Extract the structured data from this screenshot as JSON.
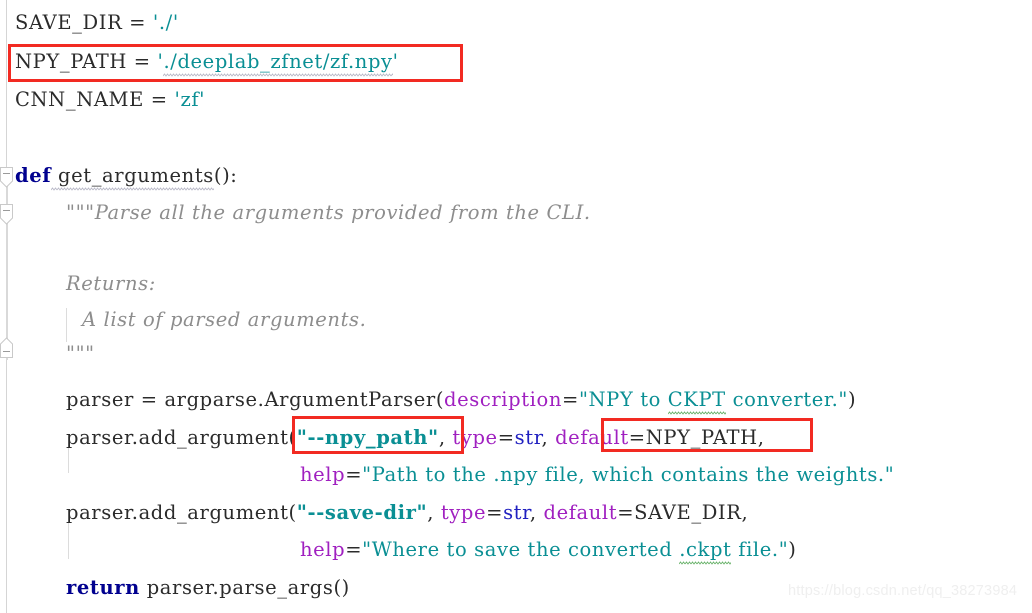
{
  "editor": {
    "language": "Python",
    "background": "#ffffff",
    "colors": {
      "keyword": "#00008f",
      "string": "#0a8f94",
      "keyword_argument": "#a020c0",
      "builtin": "#2020c0",
      "identifier": "#2b2b2b",
      "docstring": "#8d8d8d",
      "annotation_box": "#f22a22",
      "gutter_line": "#d5d5d5",
      "spellcheck_squiggle": "#b9b9c8",
      "typo_squiggle": "#69b36b",
      "watermark": "#efefef"
    }
  },
  "gutter": {
    "fold_markers": [
      {
        "name": "fold-marker-def-get-arguments",
        "state": "expanded",
        "glyph": "minus"
      },
      {
        "name": "fold-marker-docstring",
        "state": "expanded",
        "glyph": "minus"
      },
      {
        "name": "fold-marker-docstring-end",
        "state": "expanded",
        "glyph": "minus"
      }
    ]
  },
  "code": {
    "lines": [
      {
        "id": "line-save-dir",
        "text": "SAVE_DIR = './'",
        "tokens": {
          "name": "SAVE_DIR",
          "operator": "=",
          "value": "'./'"
        }
      },
      {
        "id": "line-npy-path",
        "text": "NPY_PATH = './deeplab_zfnet/zf.npy'",
        "tokens": {
          "name": "NPY_PATH",
          "operator": "=",
          "quote_open": "'",
          "value": "./deeplab_zfnet/zf.npy",
          "quote_close": "'"
        }
      },
      {
        "id": "line-cnn-name",
        "text": "CNN_NAME = 'zf'",
        "tokens": {
          "name": "CNN_NAME",
          "operator": "=",
          "value": "'zf'"
        }
      },
      {
        "id": "line-def",
        "text": "def get_arguments():",
        "tokens": {
          "keyword": "def",
          "func_name": "get_arguments",
          "parens": "()",
          "colon": ":"
        }
      },
      {
        "id": "line-doc-1",
        "text": "\"\"\"Parse all the arguments provided from the CLI."
      },
      {
        "id": "line-doc-returns",
        "text": "Returns:"
      },
      {
        "id": "line-doc-returns-body",
        "text": "A list of parsed arguments."
      },
      {
        "id": "line-doc-end",
        "text": "\"\"\""
      },
      {
        "id": "line-parser-init",
        "text": "parser = argparse.ArgumentParser(description=\"NPY to CKPT converter.\")",
        "tokens": {
          "var": "parser",
          "operator": "=",
          "module": "argparse",
          "dot": ".",
          "class": "ArgumentParser",
          "open_paren": "(",
          "kwarg": "description",
          "equals": "=",
          "string": "\"NPY to CKPT converter.\"",
          "close_paren": ")"
        }
      },
      {
        "id": "line-add-npy-path",
        "text": "parser.add_argument(\"--npy_path\", type=str, default=NPY_PATH,",
        "tokens": {
          "var": "parser",
          "dot": ".",
          "method": "add_argument",
          "open_paren": "(",
          "flag_string": "\"--npy_path\"",
          "comma1": ", ",
          "kwarg_type": "type",
          "eq1": "=",
          "builtin_str": "str",
          "comma2": ", ",
          "kwarg_default": "default",
          "eq2": "=",
          "default_value": "NPY_PATH",
          "comma3": ","
        }
      },
      {
        "id": "line-help-npy-path",
        "text": "help=\"Path to the .npy file, which contains the weights.\"",
        "tokens": {
          "kwarg": "help",
          "equals": "=",
          "string": "\"Path to the .npy file, which contains the weights.\""
        }
      },
      {
        "id": "line-add-save-dir",
        "text": "parser.add_argument(\"--save-dir\", type=str, default=SAVE_DIR,",
        "tokens": {
          "var": "parser",
          "dot": ".",
          "method": "add_argument",
          "open_paren": "(",
          "flag_string": "\"--save-dir\"",
          "comma1": ", ",
          "kwarg_type": "type",
          "eq1": "=",
          "builtin_str": "str",
          "comma2": ", ",
          "kwarg_default": "default",
          "eq2": "=",
          "default_value": "SAVE_DIR",
          "comma3": ","
        }
      },
      {
        "id": "line-help-save-dir",
        "text": "help=\"Where to save the converted .ckpt file.\")",
        "tokens": {
          "kwarg": "help",
          "equals": "=",
          "string": "\"Where to save the converted .ckpt file.\"",
          "close_paren": ")"
        }
      },
      {
        "id": "line-return",
        "text": "return parser.parse_args()",
        "tokens": {
          "keyword": "return",
          "var": "parser",
          "dot": ".",
          "method": "parse_args",
          "parens": "()"
        }
      }
    ]
  },
  "annotations": [
    {
      "name": "annotation-box-npy-path-assignment",
      "target": "NPY_PATH = './deeplab_zfnet/zf.npy'"
    },
    {
      "name": "annotation-box-npy-path-flag",
      "target": "(\"--npy_path\""
    },
    {
      "name": "annotation-box-default-npy-path",
      "target": "default=NPY_PATH,"
    }
  ],
  "watermark": {
    "text": "https://blog.csdn.net/qq_38273984"
  },
  "fragments": {
    "save_dir_name": "SAVE_DIR",
    "npy_path_name": "NPY_PATH",
    "cnn_name_name": "CNN_NAME",
    "eq_spaced": " = ",
    "save_dir_value": "'./'",
    "npy_path_q1": "'",
    "npy_path_value": "./deeplab_zfnet/zf.npy",
    "npy_path_q2": "'",
    "cnn_name_value": "'zf'",
    "kw_def": "def",
    "func_get_arguments": " get_arguments",
    "parens_colon": "():",
    "doc_line1": "\"\"\"Parse all the arguments provided from the CLI.",
    "doc_returns": "Returns:",
    "doc_returns_body": "A list of parsed arguments.",
    "doc_end": "\"\"\"",
    "parser_var": "parser",
    "eq_parser": " = ",
    "argparse_mod": "argparse.",
    "argument_parser_cls": "ArgumentParser",
    "open_paren": "(",
    "kw_description": "description",
    "eq_plain": "=",
    "str_npy_to": "\"NPY ",
    "str_to": "to ",
    "str_ckpt": "CKPT",
    "str_converter": " converter.\"",
    "close_paren": ")",
    "parser_dot": "parser.",
    "add_argument": "add_argument",
    "flag_npy_path": "\"--npy_path\"",
    "comma_space": ", ",
    "kw_type": "type",
    "builtin_str": "str",
    "comma_space2": ", ",
    "kw_default": "default",
    "val_npy_path": "NPY_PATH",
    "comma": ",",
    "kw_help": "help",
    "help_npy_str": "\"Path to the .npy file, which contains the weights.\"",
    "flag_save_dir": "\"--save-dir\"",
    "val_save_dir": "SAVE_DIR",
    "help_save_pre": "\"Where to save the converted ",
    "help_save_ckpt": ".ckpt",
    "help_save_post": " file.\"",
    "kw_return": "return",
    "parse_args_call": " parser.parse_args()"
  }
}
